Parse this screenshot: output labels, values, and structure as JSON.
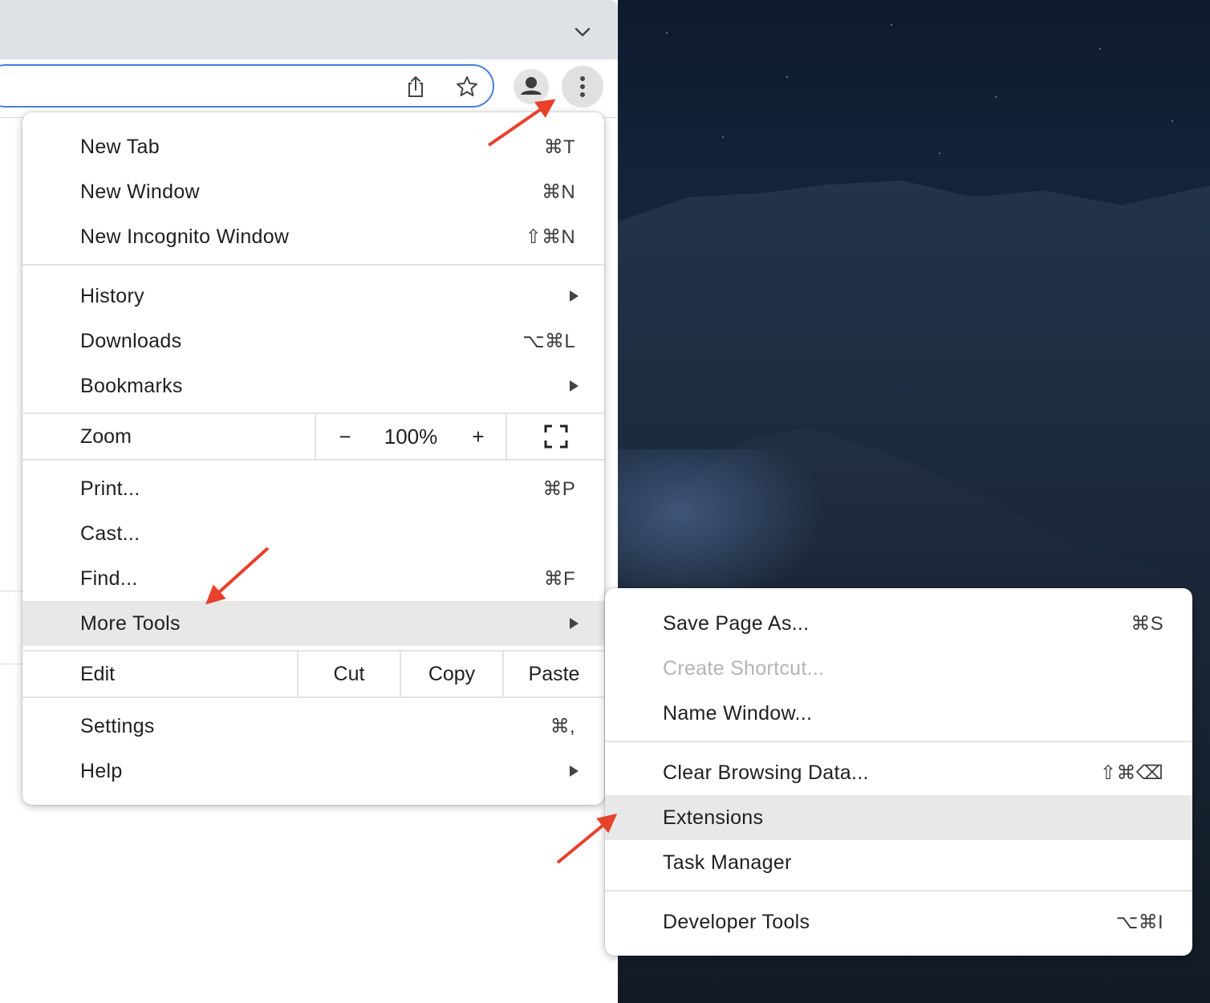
{
  "main_menu": {
    "items": [
      {
        "label": "New Tab",
        "shortcut": "⌘T"
      },
      {
        "label": "New Window",
        "shortcut": "⌘N"
      },
      {
        "label": "New Incognito Window",
        "shortcut": "⇧⌘N"
      },
      {
        "label": "History"
      },
      {
        "label": "Downloads",
        "shortcut": "⌥⌘L"
      },
      {
        "label": "Bookmarks"
      },
      {
        "label": "Print...",
        "shortcut": "⌘P"
      },
      {
        "label": "Cast..."
      },
      {
        "label": "Find...",
        "shortcut": "⌘F"
      },
      {
        "label": "More Tools"
      },
      {
        "label": "Settings",
        "shortcut": "⌘,"
      },
      {
        "label": "Help"
      }
    ],
    "zoom": {
      "label": "Zoom",
      "minus": "−",
      "value": "100%",
      "plus": "+"
    },
    "edit": {
      "label": "Edit",
      "cut": "Cut",
      "copy": "Copy",
      "paste": "Paste"
    }
  },
  "more_tools_menu": {
    "items": [
      {
        "label": "Save Page As...",
        "shortcut": "⌘S"
      },
      {
        "label": "Create Shortcut...",
        "disabled": true
      },
      {
        "label": "Name Window..."
      },
      {
        "label": "Clear Browsing Data...",
        "shortcut": "⇧⌘⌫"
      },
      {
        "label": "Extensions"
      },
      {
        "label": "Task Manager"
      },
      {
        "label": "Developer Tools",
        "shortcut": "⌥⌘I"
      }
    ]
  },
  "colors": {
    "annotation_arrow": "#e8412c",
    "omnibox_focus": "#4a7ee0",
    "highlight": "#e8e8e8"
  },
  "icons": [
    "chevron-down-icon",
    "share-icon",
    "star-icon",
    "profile-icon",
    "kebab-menu-icon",
    "fullscreen-icon"
  ]
}
